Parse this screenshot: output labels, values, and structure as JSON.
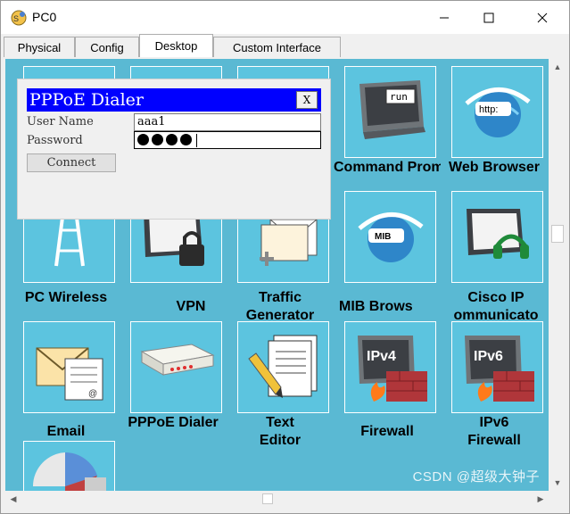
{
  "window": {
    "title": "PC0"
  },
  "tabs": [
    {
      "label": "Physical"
    },
    {
      "label": "Config"
    },
    {
      "label": "Desktop"
    },
    {
      "label": "Custom Interface"
    }
  ],
  "desktop": {
    "apps": [
      {
        "label": "Command Prompt",
        "icon": "command-prompt-icon",
        "icon_text": "run"
      },
      {
        "label": "Web Browser",
        "icon": "web-browser-icon",
        "icon_text": "http:"
      },
      {
        "label": "PC Wireless",
        "icon": "pc-wireless-icon"
      },
      {
        "label": "VPN",
        "icon": "vpn-icon"
      },
      {
        "label": "Traffic Generator",
        "icon": "traffic-generator-icon"
      },
      {
        "label": "MIB Brows",
        "icon": "mib-browser-icon",
        "icon_text": "MIB"
      },
      {
        "label": "Cisco IP ommunicato",
        "icon": "cisco-ip-communicator-icon"
      },
      {
        "label": "Email",
        "icon": "email-icon"
      },
      {
        "label": "PPPoE Dialer",
        "icon": "pppoe-dialer-icon"
      },
      {
        "label": "Text Editor",
        "icon": "text-editor-icon"
      },
      {
        "label": "Firewall",
        "icon": "firewall-icon",
        "icon_text": "IPv4"
      },
      {
        "label": "IPv6 Firewall",
        "icon": "ipv6-firewall-icon",
        "icon_text": "IPv6"
      }
    ]
  },
  "dialog": {
    "title": "PPPoE Dialer",
    "close_label": "X",
    "username_label": "User Name",
    "username_value": "aaa1",
    "password_label": "Password",
    "password_length": 4,
    "connect_label": "Connect"
  },
  "watermark": "CSDN @超级大钟子",
  "colors": {
    "desktop_bg": "#5ab9d3",
    "dialog_title_bg": "#0000ff",
    "tile_bg": "#5cc4df"
  }
}
